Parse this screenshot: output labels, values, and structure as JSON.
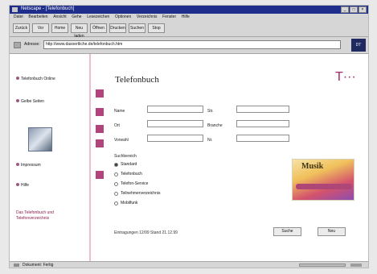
{
  "window": {
    "title": "Netscape - [Telefonbuch]"
  },
  "menu": {
    "items": [
      "Datei",
      "Bearbeiten",
      "Ansicht",
      "Gehe",
      "Lesezeichen",
      "Optionen",
      "Verzeichnis",
      "Fenster",
      "Hilfe"
    ]
  },
  "toolbar": {
    "back": "Zurück",
    "forward": "Vor",
    "home": "Home",
    "reload": "Neu laden",
    "open": "Öffnen",
    "print": "Drucken",
    "find": "Suchen",
    "stop": "Stop"
  },
  "address": {
    "label": "Adresse:",
    "value": "http://www.dasoertliche.de/telefonbuch.htm"
  },
  "logo": {
    "text": "DT"
  },
  "sidebar": {
    "items": [
      {
        "label": "Telefonbuch Online"
      },
      {
        "label": "Gelbe Seiten"
      },
      {
        "label": "Impressum"
      },
      {
        "label": "Hilfe"
      }
    ],
    "promo": "Das Telefonbuch und Telefonverzeichnis"
  },
  "page": {
    "title": "Telefonbuch",
    "tlogo": "T···"
  },
  "form": {
    "left": [
      {
        "label": "Name"
      },
      {
        "label": "Ort"
      },
      {
        "label": "Vorwahl"
      }
    ],
    "right": [
      {
        "label": "Str."
      },
      {
        "label": "Branche"
      },
      {
        "label": "Nr."
      }
    ]
  },
  "radio": {
    "label": "Suchbereich",
    "options": [
      {
        "label": "Standard",
        "selected": true
      },
      {
        "label": "Telefonbuch",
        "selected": false
      },
      {
        "label": "Telefon-Service",
        "selected": false
      },
      {
        "label": "Teilnehmerverzeichnis",
        "selected": false
      },
      {
        "label": "Mobilfunk",
        "selected": false
      }
    ]
  },
  "note": "Eintragungen 12/99 Stand 21.12.99",
  "buttons": {
    "search": "Suche",
    "reset": "Neu"
  },
  "ad": {
    "brand": "Musik"
  },
  "status": {
    "text": "Dokument: Fertig"
  },
  "colors": {
    "accent": "#a1286d",
    "title_bar": "#1f2e8a"
  }
}
